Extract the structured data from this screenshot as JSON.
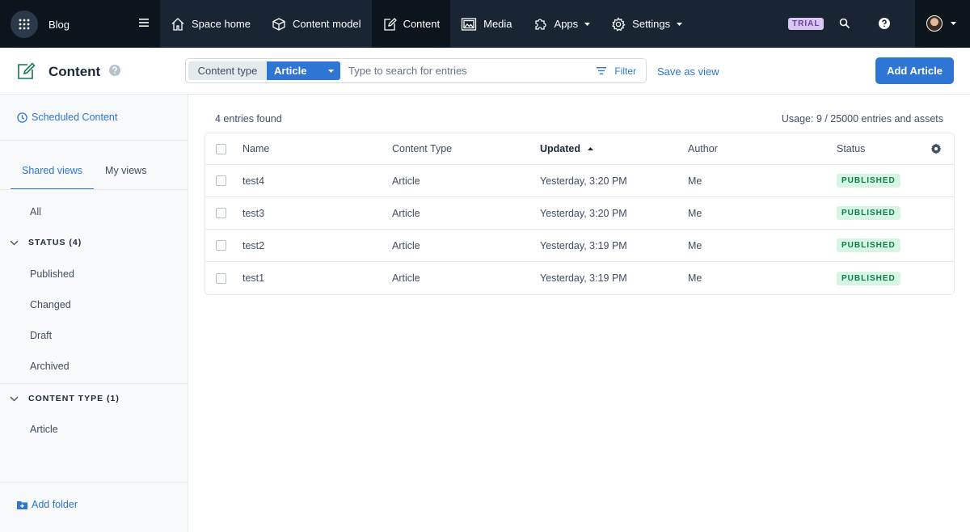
{
  "space": {
    "name": "Blog"
  },
  "topnav": {
    "items": [
      {
        "label": "Space home",
        "icon": "home-icon"
      },
      {
        "label": "Content model",
        "icon": "cube-icon"
      },
      {
        "label": "Content",
        "icon": "edit-icon"
      },
      {
        "label": "Media",
        "icon": "image-icon"
      },
      {
        "label": "Apps",
        "icon": "puzzle-icon"
      },
      {
        "label": "Settings",
        "icon": "gear-icon"
      }
    ],
    "trial_badge": "TRIAL"
  },
  "workbench": {
    "title": "Content",
    "search": {
      "content_type_label": "Content type",
      "content_type_value": "Article",
      "placeholder": "Type to search for entries",
      "filter_label": "Filter"
    },
    "save_as_view": "Save as view",
    "add_button": "Add Article"
  },
  "sidebar": {
    "scheduled": "Scheduled Content",
    "tabs": [
      "Shared views",
      "My views"
    ],
    "all": "All",
    "status_group": "STATUS (4)",
    "status_items": [
      "Published",
      "Changed",
      "Draft",
      "Archived"
    ],
    "content_type_group": "CONTENT TYPE (1)",
    "content_type_items": [
      "Article"
    ],
    "add_folder": "Add folder"
  },
  "main": {
    "entries_found": "4 entries found",
    "usage": "Usage: 9 / 25000 entries and assets",
    "columns": [
      "Name",
      "Content Type",
      "Updated",
      "Author",
      "Status"
    ],
    "rows": [
      {
        "name": "test4",
        "type": "Article",
        "updated": "Yesterday, 3:20 PM",
        "author": "Me",
        "status": "PUBLISHED"
      },
      {
        "name": "test3",
        "type": "Article",
        "updated": "Yesterday, 3:20 PM",
        "author": "Me",
        "status": "PUBLISHED"
      },
      {
        "name": "test2",
        "type": "Article",
        "updated": "Yesterday, 3:19 PM",
        "author": "Me",
        "status": "PUBLISHED"
      },
      {
        "name": "test1",
        "type": "Article",
        "updated": "Yesterday, 3:19 PM",
        "author": "Me",
        "status": "PUBLISHED"
      }
    ]
  },
  "colors": {
    "nav_bg": "#192532",
    "nav_active_bg": "#0c141c",
    "accent_blue": "#2e75d4",
    "published_bg": "#d7f5e3",
    "published_text": "#0d7b45",
    "trial_bg": "#d9c6f1"
  }
}
